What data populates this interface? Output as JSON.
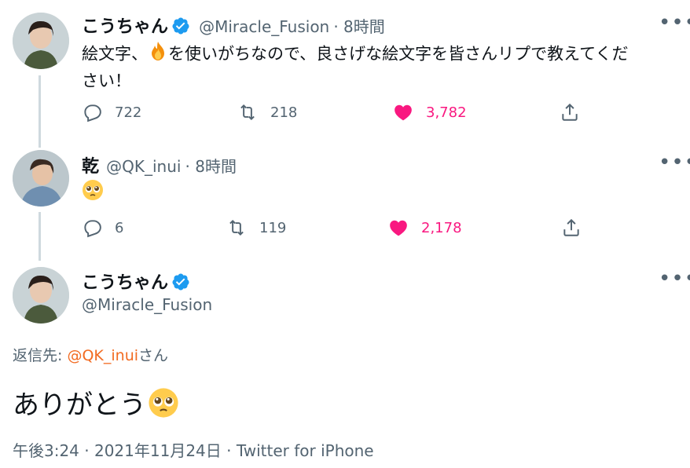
{
  "tweet1": {
    "name": "こうちゃん",
    "handle": "@Miracle_Fusion",
    "time": "· 8時間",
    "text_part1": "絵文字、",
    "text_part2": "を使いがちなので、良さげな絵文字を皆さんリプで教えてくだ",
    "text_part3": "さい！",
    "emoji": "fire-emoji",
    "replies": "722",
    "retweets": "218",
    "likes": "3,782"
  },
  "tweet2": {
    "name": "乾",
    "handle": "@QK_inui",
    "time": "· 8時間",
    "emoji": "pleading-face-emoji",
    "replies": "6",
    "retweets": "119",
    "likes": "2,178"
  },
  "main": {
    "name": "こうちゃん",
    "handle": "@Miracle_Fusion",
    "reply_label": "返信先:",
    "reply_mention": "@QK_inui",
    "reply_suffix": "さん",
    "text": "ありがとう",
    "emoji": "pleading-face-emoji",
    "footer": "午後3:24 · 2021年11月24日 · Twitter for iPhone"
  },
  "more": "•••",
  "colors": {
    "like": "#f91880",
    "verified": "#1d9bf0",
    "mention": "#f26b21",
    "thread": "#cfd9de"
  }
}
